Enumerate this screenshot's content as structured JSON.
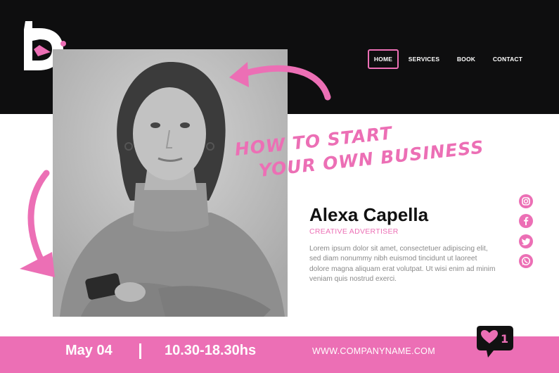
{
  "nav": {
    "items": [
      {
        "label": "HOME",
        "active": true
      },
      {
        "label": "SERVICES",
        "active": false
      },
      {
        "label": "BOOK",
        "active": false
      },
      {
        "label": "CONTACT",
        "active": false
      }
    ]
  },
  "hero": {
    "headline_line1": "HOW TO START",
    "headline_line2": "YOUR OWN BUSINESS",
    "name": "Alexa Capella",
    "role": "CREATIVE ADVERTISER",
    "description": "Lorem ipsum dolor sit amet, consectetuer adipiscing elit, sed diam nonummy nibh euismod tincidunt ut laoreet dolore magna aliquam erat volutpat. Ut wisi enim ad minim veniam quis nostrud exerci."
  },
  "social": [
    "instagram-icon",
    "facebook-icon",
    "twitter-icon",
    "whatsapp-icon"
  ],
  "footer": {
    "date": "May 04",
    "separator": "|",
    "time": "10.30-18.30hs",
    "website": "WWW.COMPANYNAME.COM"
  },
  "notification": {
    "count": "1"
  },
  "colors": {
    "accent": "#ec6fb5",
    "dark": "#0e0e0f"
  }
}
